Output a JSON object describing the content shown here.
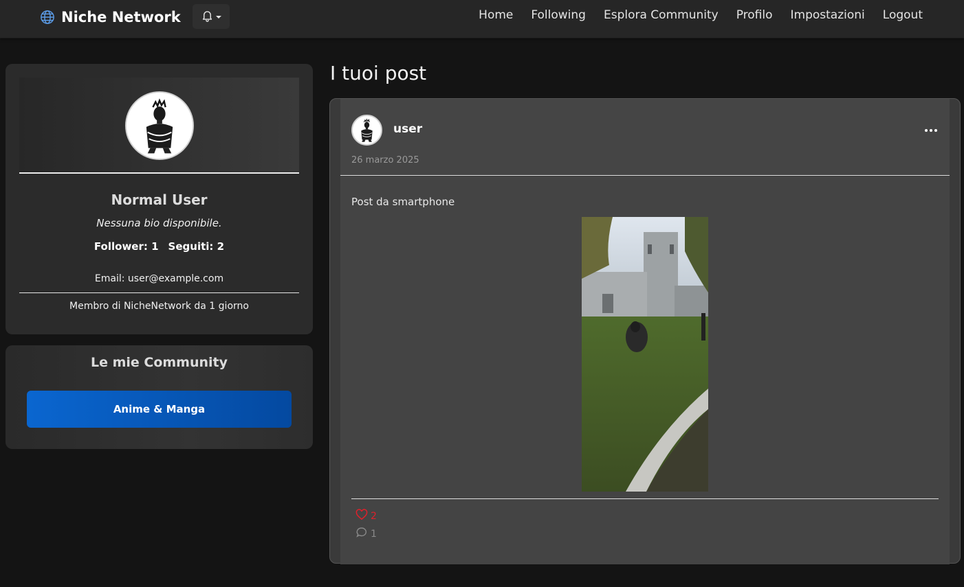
{
  "navbar": {
    "brand": "Niche Network",
    "brand_icon": "globe-icon",
    "notification_icon": "bell-icon",
    "links": [
      "Home",
      "Following",
      "Esplora Community",
      "Profilo",
      "Impostazioni",
      "Logout"
    ]
  },
  "profile": {
    "name": "Normal User",
    "bio": "Nessuna bio disponibile.",
    "followers": "Follower: 1",
    "following": "Seguiti: 2",
    "email": "Email: user@example.com",
    "member_since": "Membro di NicheNetwork da 1 giorno"
  },
  "communities": {
    "title": "Le mie Community",
    "items": [
      "Anime & Manga"
    ]
  },
  "posts_section": {
    "title": "I tuoi post"
  },
  "post": {
    "username": "user",
    "date": "26 marzo 2025",
    "text": "Post da smartphone",
    "likes": "2",
    "comments": "1",
    "like_icon": "heart-icon",
    "comment_icon": "comment-icon",
    "menu_icon": "more-icon"
  },
  "colors": {
    "background": "#141414",
    "navbar": "#262626",
    "card": "#2b2b2b",
    "accent_blue": "#0a66d0",
    "like_red": "#e0202a"
  }
}
